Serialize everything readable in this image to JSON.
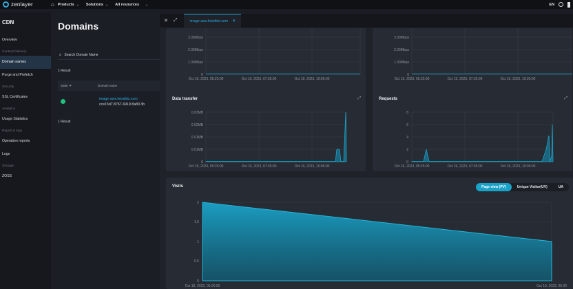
{
  "topbar": {
    "brand": "zenlayer",
    "nav": [
      {
        "label": "Products"
      },
      {
        "label": "Solutions"
      },
      {
        "label": "All resources"
      }
    ],
    "lang": "EN"
  },
  "sidebar": {
    "title": "CDN",
    "items": [
      {
        "type": "item",
        "label": "Overview"
      },
      {
        "type": "group",
        "label": "Content Delivery"
      },
      {
        "type": "item",
        "label": "Domain names",
        "active": true
      },
      {
        "type": "item",
        "label": "Purge and Prefetch"
      },
      {
        "type": "group",
        "label": "Security"
      },
      {
        "type": "item",
        "label": "SSL Certificates"
      },
      {
        "type": "group",
        "label": "Analytics"
      },
      {
        "type": "item",
        "label": "Usage Statistics"
      },
      {
        "type": "group",
        "label": "Report & logs"
      },
      {
        "type": "item",
        "label": "Operation reports"
      },
      {
        "type": "item",
        "label": "Logs"
      },
      {
        "type": "group",
        "label": "Storage"
      },
      {
        "type": "item",
        "label": "ZOSS"
      }
    ]
  },
  "domains": {
    "title": "Domains",
    "search_placeholder": "Search Domain Name",
    "result_top": "1 Result",
    "result_bottom": "1 Result",
    "col_state": "State",
    "col_domain": "Domain name",
    "row": {
      "domain": "image-aws.letsdido.com",
      "id": "cce15d7.8767-6919.8a80.3b"
    }
  },
  "panel": {
    "tab_label": "image-aws.letsdido.com",
    "accent": "#2aa9e0"
  },
  "charts": {
    "bandwidth_left": {
      "type": "line",
      "yticks": [
        "3.00Mbps",
        "2.00Mbps",
        "1.00Mbps",
        "0"
      ],
      "xticks": [
        "Oct 19, 2023, 05:25:00",
        "Oct 19, 2023, 07:35:00",
        "Oct 19, 2023, 10:05:00"
      ]
    },
    "bandwidth_right": {
      "type": "line",
      "yticks": [
        "3.00Mbps",
        "2.00Mbps",
        "1.00Mbps",
        "0"
      ],
      "xticks": [
        "Oct 19, 2023, 05:25:00",
        "Oct 19, 2023, 07:35:00",
        "Oct 19, 2023, 10:05:00"
      ]
    },
    "data_transfer": {
      "title": "Data transfer",
      "type": "area",
      "yticks": [
        "0.02MB",
        "0.02MB",
        "0.01MB",
        "0.01MB",
        "0"
      ],
      "xticks": [
        "Oct 19, 2023, 05:25:00",
        "Oct 19, 2023, 07:35:00",
        "Oct 19, 2023, 10:05:00"
      ]
    },
    "requests": {
      "title": "Requests",
      "type": "area",
      "yticks": [
        "8",
        "6",
        "4",
        "2",
        "0"
      ],
      "xticks": [
        "Oct 19, 2023, 05:25:00",
        "Oct 19, 2023, 07:35:00",
        "Oct 19, 2023, 10:05:00"
      ]
    },
    "visits": {
      "title": "Visits",
      "tabs": [
        "Page view (PV)",
        "Unique Visitor(UV)",
        "UA"
      ],
      "active_tab": 0,
      "yticks": [
        "2",
        "1.5",
        "1",
        "0.5",
        "0"
      ],
      "xticks": [
        "Oct 18, 2023, 05:00:00",
        "Oct 19, 2023, 05:00"
      ]
    }
  },
  "chart_data": {
    "type": "area",
    "title": "Visits",
    "x": [
      "Oct 18, 2023, 05:00:00",
      "Oct 19, 2023, 05:00"
    ],
    "series": [
      {
        "name": "Page view (PV)",
        "values": [
          2,
          1
        ]
      }
    ],
    "ylim": [
      0,
      2
    ],
    "grid": true,
    "color": "#1aa3c9"
  }
}
